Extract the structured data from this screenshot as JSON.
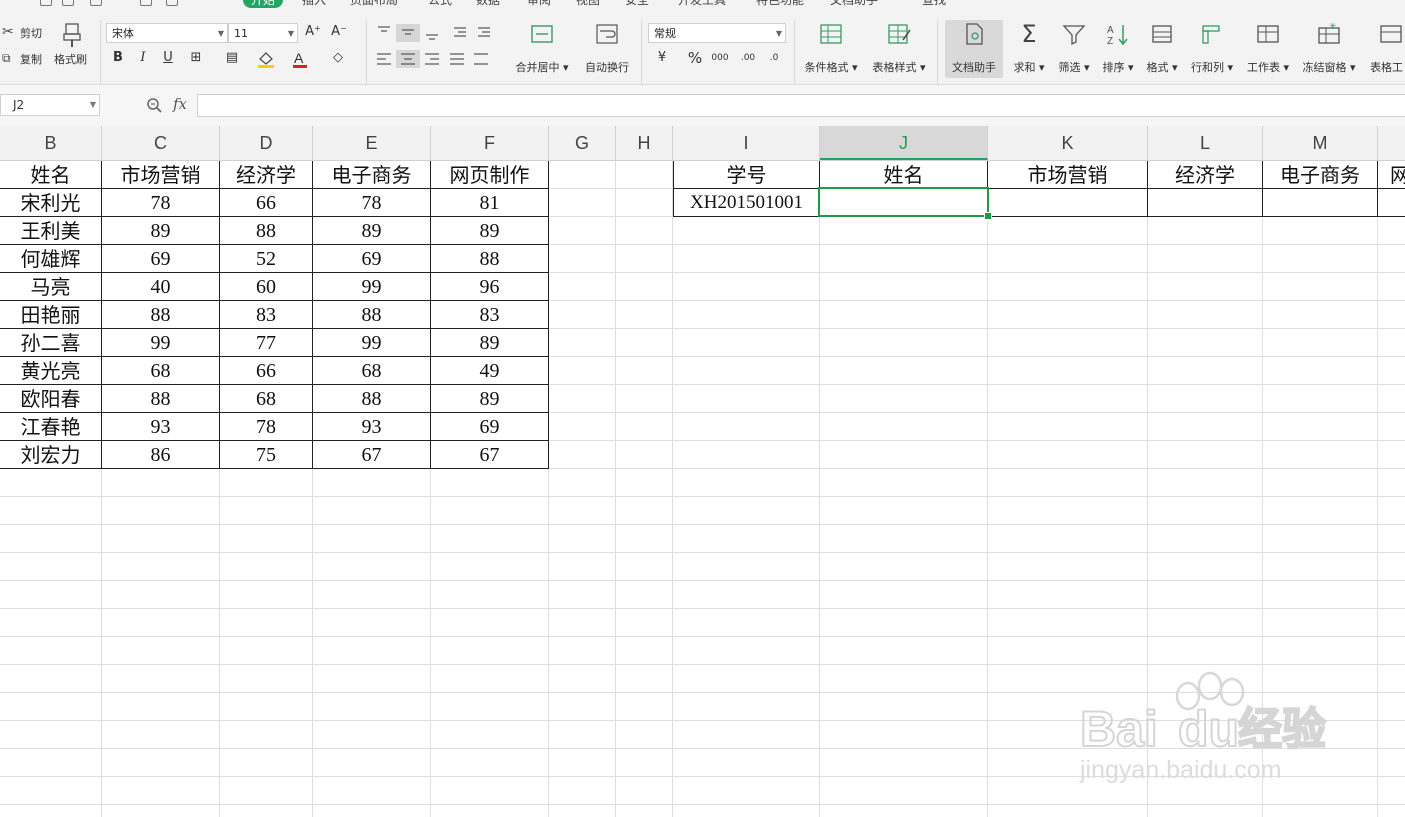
{
  "menu": {
    "tabs": [
      "开始",
      "插入",
      "页面布局",
      "公式",
      "数据",
      "审阅",
      "视图",
      "安全",
      "开发工具",
      "特色功能",
      "文档助手",
      "查找"
    ],
    "active_tab": "开始"
  },
  "ribbon": {
    "clipboard": {
      "cut": "剪切",
      "copy": "复制",
      "format_painter": "格式刷"
    },
    "font": {
      "name": "宋体",
      "size": "11"
    },
    "alignment": {
      "merge_center": "合并居中",
      "wrap_text": "自动换行"
    },
    "number": {
      "format": "常规"
    },
    "styles": {
      "conditional_format": "条件格式",
      "table_style": "表格样式"
    },
    "tools": {
      "doc_assistant": "文档助手",
      "sum": "求和",
      "filter": "筛选",
      "sort": "排序",
      "format": "格式",
      "row_col": "行和列",
      "worksheet": "工作表",
      "freeze": "冻结窗格",
      "table_tools": "表格工"
    }
  },
  "formula_bar": {
    "name_box": "J2",
    "fx": "fx",
    "formula": ""
  },
  "columns": [
    "B",
    "C",
    "D",
    "E",
    "F",
    "G",
    "H",
    "I",
    "J",
    "K",
    "L",
    "M"
  ],
  "selected_column": "J",
  "left_table": {
    "headers": [
      "姓名",
      "市场营销",
      "经济学",
      "电子商务",
      "网页制作"
    ],
    "rows": [
      [
        "宋利光",
        "78",
        "66",
        "78",
        "81"
      ],
      [
        "王利美",
        "89",
        "88",
        "89",
        "89"
      ],
      [
        "何雄辉",
        "69",
        "52",
        "69",
        "88"
      ],
      [
        "马亮",
        "40",
        "60",
        "99",
        "96"
      ],
      [
        "田艳丽",
        "88",
        "83",
        "88",
        "83"
      ],
      [
        "孙二喜",
        "99",
        "77",
        "99",
        "89"
      ],
      [
        "黄光亮",
        "68",
        "66",
        "68",
        "49"
      ],
      [
        "欧阳春",
        "88",
        "68",
        "88",
        "89"
      ],
      [
        "江春艳",
        "93",
        "78",
        "93",
        "69"
      ],
      [
        "刘宏力",
        "86",
        "75",
        "67",
        "67"
      ]
    ]
  },
  "right_table": {
    "headers": [
      "学号",
      "姓名",
      "市场营销",
      "经济学",
      "电子商务",
      "网"
    ],
    "row": [
      "XH201501001",
      "",
      "",
      "",
      "",
      ""
    ]
  },
  "watermark": {
    "brand": "Bai",
    "brand2": "du",
    "cn": "经验",
    "url": "jingyan.baidu.com"
  },
  "colors": {
    "accent_green": "#1e9b47",
    "ribbon_bg": "#f3f3f3",
    "header_bg": "#f2f2f2"
  }
}
